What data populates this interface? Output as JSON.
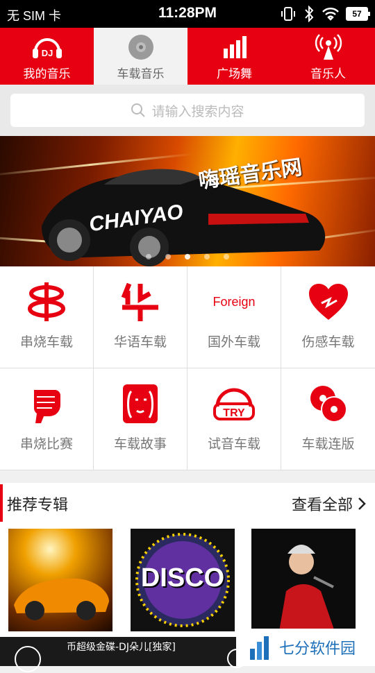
{
  "status_bar": {
    "carrier": "无 SIM 卡",
    "time": "11:28PM",
    "battery": "57",
    "icons": [
      "vibrate-icon",
      "bluetooth-icon",
      "wifi-icon",
      "battery-icon"
    ]
  },
  "tabs": [
    {
      "label": "我的音乐",
      "icon": "dj-headphones-icon",
      "active": false
    },
    {
      "label": "车载音乐",
      "icon": "disc-icon",
      "active": true
    },
    {
      "label": "广场舞",
      "icon": "signal-bars-icon",
      "active": false
    },
    {
      "label": "音乐人",
      "icon": "broadcast-icon",
      "active": false
    }
  ],
  "search": {
    "placeholder": "请输入搜索内容"
  },
  "banner": {
    "brand_text": "嗨瑶音乐网",
    "logo_text": "CHAIYAO",
    "slide_count": 5,
    "active_slide": 3
  },
  "categories": [
    {
      "label": "串烧车载",
      "icon": "chuan-icon"
    },
    {
      "label": "华语车载",
      "icon": "hua-icon"
    },
    {
      "label": "国外车载",
      "icon": "foreign-icon",
      "icon_text": "Foreign"
    },
    {
      "label": "伤感车载",
      "icon": "broken-heart-icon"
    },
    {
      "label": "串烧比赛",
      "icon": "fist-icon"
    },
    {
      "label": "车载故事",
      "icon": "faces-icon"
    },
    {
      "label": "试音车载",
      "icon": "try-headphones-icon",
      "icon_text": "TRY"
    },
    {
      "label": "车载连版",
      "icon": "discs-icon"
    }
  ],
  "section": {
    "title": "推荐专辑",
    "more_label": "查看全部"
  },
  "albums": [
    {
      "name": "album-sports-car"
    },
    {
      "name": "album-disco",
      "cover_text": "DISCO"
    },
    {
      "name": "album-singer"
    }
  ],
  "player": {
    "now_playing": "币超级金碟-DJ朵儿[独家]"
  },
  "watermark": {
    "text": "七分软件园"
  },
  "colors": {
    "accent": "#e60012",
    "active_tab_bg": "#f2f2f2",
    "search_bg": "#e9e9ea"
  }
}
